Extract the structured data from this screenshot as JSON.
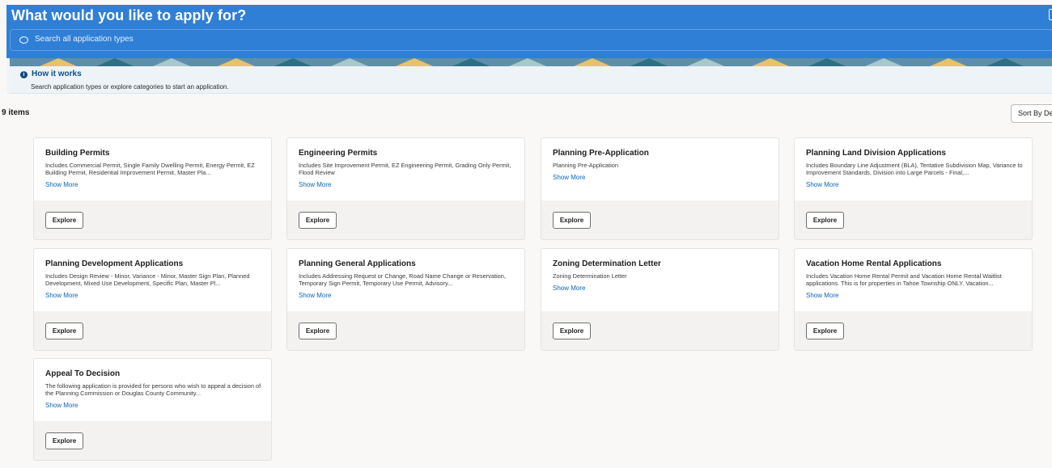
{
  "header": {
    "title": "What would you like to apply for?",
    "search_placeholder": "Search all application types"
  },
  "how_it_works": {
    "title": "How it works",
    "description": "Search application types or explore categories to start an application."
  },
  "results": {
    "count_label": "9 items",
    "sort_label": "Sort By De"
  },
  "cards": [
    {
      "title": "Building Permits",
      "description": "Includes Commercial Permit, Single Family Dwelling Permit, Energy Permit, EZ Building Permit, Residential Improvement Permit, Master Pla...",
      "more": "Show More",
      "action": "Explore"
    },
    {
      "title": "Engineering Permits",
      "description": "Includes Site Improvement Permit, EZ Engineering Permit, Grading Only Permit, Flood Review",
      "more": "Show More",
      "action": "Explore"
    },
    {
      "title": "Planning Pre-Application",
      "description": "Planning Pre-Application",
      "more": "Show More",
      "action": "Explore"
    },
    {
      "title": "Planning Land Division Applications",
      "description": "Includes Boundary Line Adjustment (BLA), Tentative Subdivision Map, Variance to Improvement Standards, Division into Large Parcels - Final,...",
      "more": "Show More",
      "action": "Explore"
    },
    {
      "title": "Planning Development Applications",
      "description": "Includes Design Review - Minor, Variance - Minor, Master Sign Plan, Planned Development, Mixed Use Development, Specific Plan, Master Pl...",
      "more": "Show More",
      "action": "Explore"
    },
    {
      "title": "Planning General Applications",
      "description": "Includes Addressing Request or Change, Road Name Change or Reservation, Temporary Sign Permit, Temporary Use Permit, Advisory...",
      "more": "Show More",
      "action": "Explore"
    },
    {
      "title": "Zoning Determination Letter",
      "description": "Zoning Determination Letter",
      "more": "Show More",
      "action": "Explore"
    },
    {
      "title": "Vacation Home Rental Applications",
      "description": "Includes Vacation Home Rental Permit and Vacation Home Rental Waitlist applications. This is for properties in Tahoe Township ONLY. Vacation...",
      "more": "Show More",
      "action": "Explore"
    },
    {
      "title": "Appeal To Decision",
      "description": "The following application is provided for persons who wish to appeal a decision of the Planning Commission or Douglas County Community...",
      "more": "Show More",
      "action": "Explore"
    }
  ],
  "colors": {
    "header_blue": "#2f7fd6",
    "link_blue": "#0e66b8",
    "how_title_blue": "#0b4f8a"
  },
  "icons": {
    "search": "search-icon",
    "info": "info-icon"
  }
}
